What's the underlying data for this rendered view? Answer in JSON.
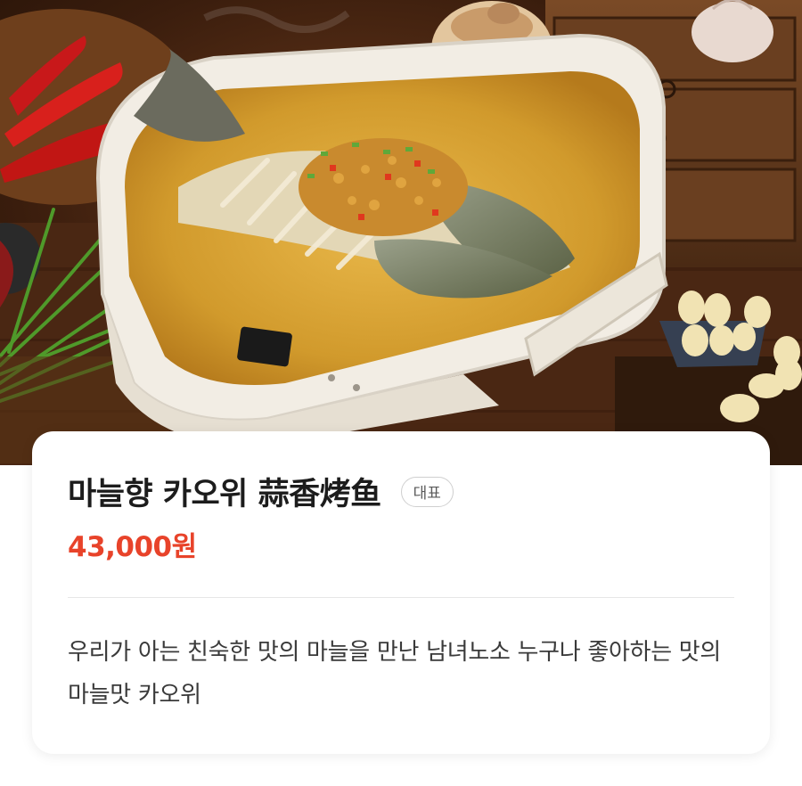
{
  "menu_item": {
    "name": "마늘향 카오위 蒜香烤鱼",
    "badge": "대표",
    "price": "43,000원",
    "description": "우리가 아는 친숙한 맛의 마늘을 만난 남녀노소 누구나 좋아하는 맛의 마늘맛 카오위"
  },
  "colors": {
    "price": "#e8432a",
    "title": "#1c1c1c",
    "badge_border": "#cfcfcf"
  }
}
